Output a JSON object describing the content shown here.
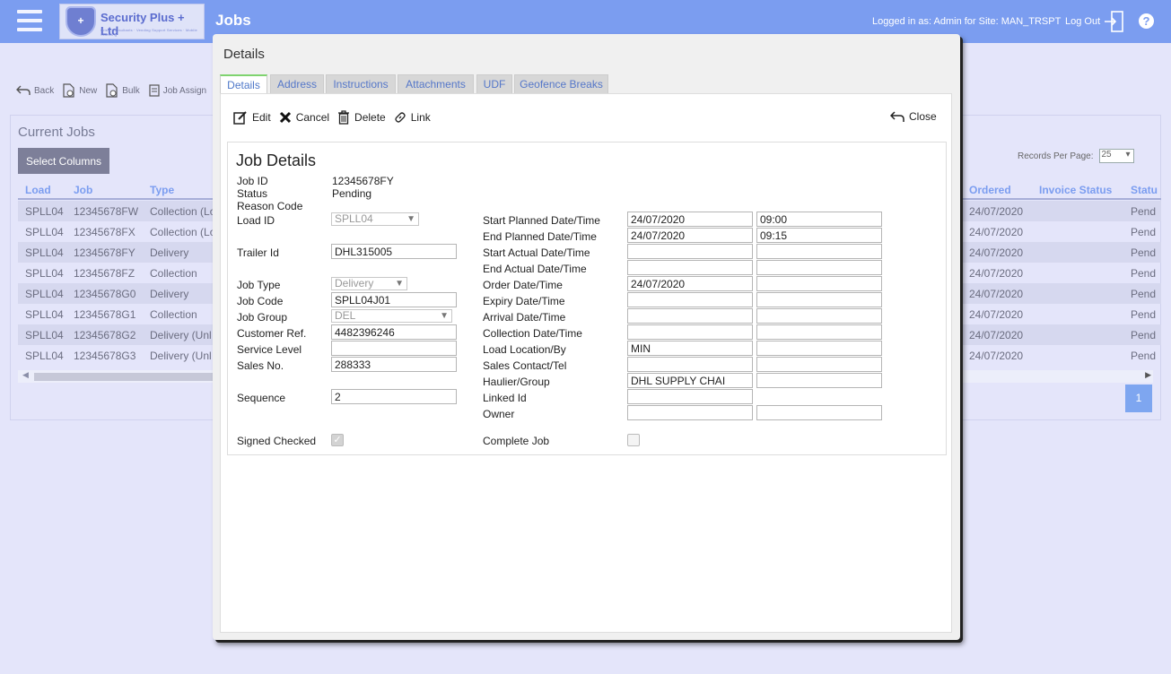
{
  "header": {
    "company": "Security Plus + Ltd",
    "company_tagline": "Crisis Consultants · Vending Support Services · Mobile Scanning",
    "logo_text": "+",
    "app_title": "Jobs",
    "logged_in": "Logged in as: Admin for Site: MAN_TRSPT",
    "logout_label": "Log Out",
    "help_glyph": "?"
  },
  "toolbar": {
    "back": "Back",
    "new": "New",
    "bulk": "Bulk",
    "job_assign": "Job Assign"
  },
  "jobs_panel": {
    "title": "Current Jobs",
    "select_columns": "Select Columns",
    "records_per_page_label": "Records Per Page:",
    "records_per_page_value": "25",
    "page": "1",
    "columns": {
      "load": "Load",
      "job": "Job",
      "type": "Type",
      "ordered": "Ordered",
      "invoice_status": "Invoice Status",
      "status": "Statu"
    },
    "rows": [
      {
        "load": "SPLL04",
        "job": "12345678FW",
        "type": "Collection (Lo",
        "ordered": "24/07/2020",
        "status": "Pend"
      },
      {
        "load": "SPLL04",
        "job": "12345678FX",
        "type": "Collection (Lo",
        "ordered": "24/07/2020",
        "status": "Pend"
      },
      {
        "load": "SPLL04",
        "job": "12345678FY",
        "type": "Delivery",
        "ordered": "24/07/2020",
        "status": "Pend"
      },
      {
        "load": "SPLL04",
        "job": "12345678FZ",
        "type": "Collection",
        "ordered": "24/07/2020",
        "status": "Pend"
      },
      {
        "load": "SPLL04",
        "job": "12345678G0",
        "type": "Delivery",
        "ordered": "24/07/2020",
        "status": "Pend"
      },
      {
        "load": "SPLL04",
        "job": "12345678G1",
        "type": "Collection",
        "ordered": "24/07/2020",
        "status": "Pend"
      },
      {
        "load": "SPLL04",
        "job": "12345678G2",
        "type": "Delivery (Unl",
        "ordered": "24/07/2020",
        "status": "Pend"
      },
      {
        "load": "SPLL04",
        "job": "12345678G3",
        "type": "Delivery (Unl",
        "ordered": "24/07/2020",
        "status": "Pend"
      }
    ]
  },
  "modal": {
    "title": "Details",
    "tabs": [
      "Details",
      "Address",
      "Instructions",
      "Attachments",
      "UDF",
      "Geofence Breaks"
    ],
    "actions": {
      "edit": "Edit",
      "cancel": "Cancel",
      "delete": "Delete",
      "link": "Link",
      "close": "Close"
    },
    "job_details": {
      "title": "Job Details",
      "labels": {
        "job_id": "Job ID",
        "status": "Status",
        "reason_code": "Reason Code",
        "load_id": "Load ID",
        "trailer_id": "Trailer Id",
        "job_type": "Job Type",
        "job_code": "Job Code",
        "job_group": "Job Group",
        "customer_ref": "Customer Ref.",
        "service_level": "Service Level",
        "sales_no": "Sales No.",
        "sequence": "Sequence",
        "signed_checked": "Signed Checked",
        "start_planned": "Start Planned Date/Time",
        "end_planned": "End Planned Date/Time",
        "start_actual": "Start Actual Date/Time",
        "end_actual": "End Actual Date/Time",
        "order_date": "Order Date/Time",
        "expiry_date": "Expiry Date/Time",
        "arrival_date": "Arrival Date/Time",
        "collection_date": "Collection Date/Time",
        "load_location": "Load Location/By",
        "sales_contact": "Sales Contact/Tel",
        "haulier_group": "Haulier/Group",
        "linked_id": "Linked Id",
        "owner": "Owner",
        "complete_job": "Complete Job"
      },
      "values": {
        "job_id": "12345678FY",
        "status": "Pending",
        "reason_code": "",
        "load_id": "SPLL04",
        "trailer_id": "DHL315005",
        "job_type": "Delivery",
        "job_code": "SPLL04J01",
        "job_group": "DEL",
        "customer_ref": "4482396246",
        "service_level": "",
        "sales_no": "288333",
        "sequence": "2",
        "signed_checked": true,
        "start_planned_date": "24/07/2020",
        "start_planned_time": "09:00",
        "end_planned_date": "24/07/2020",
        "end_planned_time": "09:15",
        "start_actual_date": "",
        "start_actual_time": "",
        "end_actual_date": "",
        "end_actual_time": "",
        "order_date": "24/07/2020",
        "order_time": "",
        "expiry_date": "",
        "expiry_time": "",
        "arrival_date": "",
        "arrival_time": "",
        "collection_date": "",
        "collection_time": "",
        "load_location": "MIN",
        "load_by": "",
        "sales_contact": "",
        "sales_tel": "",
        "haulier": "DHL SUPPLY CHAI",
        "group": "",
        "linked_id": "",
        "owner_1": "",
        "owner_2": "",
        "complete_job": false
      }
    }
  }
}
